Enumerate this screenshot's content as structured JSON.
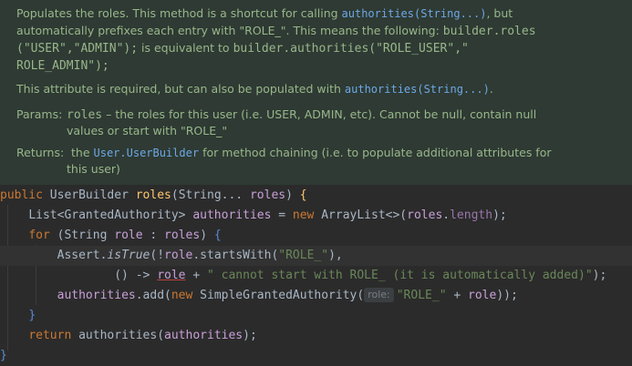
{
  "doc": {
    "p1_a": "Populates the roles. This method is a shortcut for calling ",
    "p1_link": "authorities(String...)",
    "p1_b": ", but",
    "p1_c": "automatically prefixes each entry with \"ROLE_\". This means the following: ",
    "p1_code1": "builder.roles",
    "p1_code2": "(\"USER\",\"ADMIN\");",
    "p1_d": " is equivalent to ",
    "p1_code3": "builder.authorities(\"ROLE_USER\",\"",
    "p1_code4": "ROLE_ADMIN\");",
    "p2_a": "This attribute is required, but can also be populated with ",
    "p2_link": "authorities(String...)",
    "p2_b": ".",
    "params_tag": "Params:",
    "params_name": "roles",
    "params_desc1": " – the roles for this user (i.e. USER, ADMIN, etc). Cannot be null, contain null",
    "params_desc2": "values or start with \"ROLE_\"",
    "returns_tag": "Returns:",
    "returns_a": "the ",
    "returns_link": "User.UserBuilder",
    "returns_b": " for method chaining (i.e. to populate additional attributes for",
    "returns_c": "this user)"
  },
  "code": {
    "l1": {
      "kw": "public ",
      "type": "UserBuilder ",
      "fn": "roles",
      "open": "(",
      "ptype": "String... ",
      "pname": "roles",
      "close": ") ",
      "brace": "{"
    },
    "l2": {
      "type": "List<GrantedAuthority> ",
      "var": "authorities",
      "eq": " = ",
      "kw": "new ",
      "ctor": "ArrayList<>(",
      "arg": "roles",
      "dot": ".",
      "field": "length",
      "end": ");"
    },
    "l3": {
      "kw": "for ",
      "open": "(",
      "type": "String ",
      "var": "role",
      "colon": " : ",
      "arg": "roles",
      "close": ") ",
      "brace": "{"
    },
    "l4": {
      "cls": "Assert.",
      "fn": "isTrue",
      "open": "(!",
      "var": "role",
      "call": ".startsWith(",
      "str": "\"ROLE_\"",
      "end": "),"
    },
    "l5": {
      "lambda": "() -> ",
      "var": "role",
      "plus": " + ",
      "str": "\" cannot start with ROLE_ (it is automatically added)\"",
      "end": ");"
    },
    "l6": {
      "var": "authorities",
      "call": ".add(",
      "kw": "new ",
      "ctor": "SimpleGrantedAuthority(",
      "hint": "role:",
      "str": "\"ROLE_\"",
      "plus": " + ",
      "arg": "role",
      "end": "));"
    },
    "l7": {
      "brace": "}"
    },
    "l8": {
      "kw": "return ",
      "fn": "authorities",
      "open": "(",
      "arg": "authorities",
      "end": ");"
    },
    "l9": {
      "brace": "}"
    }
  }
}
